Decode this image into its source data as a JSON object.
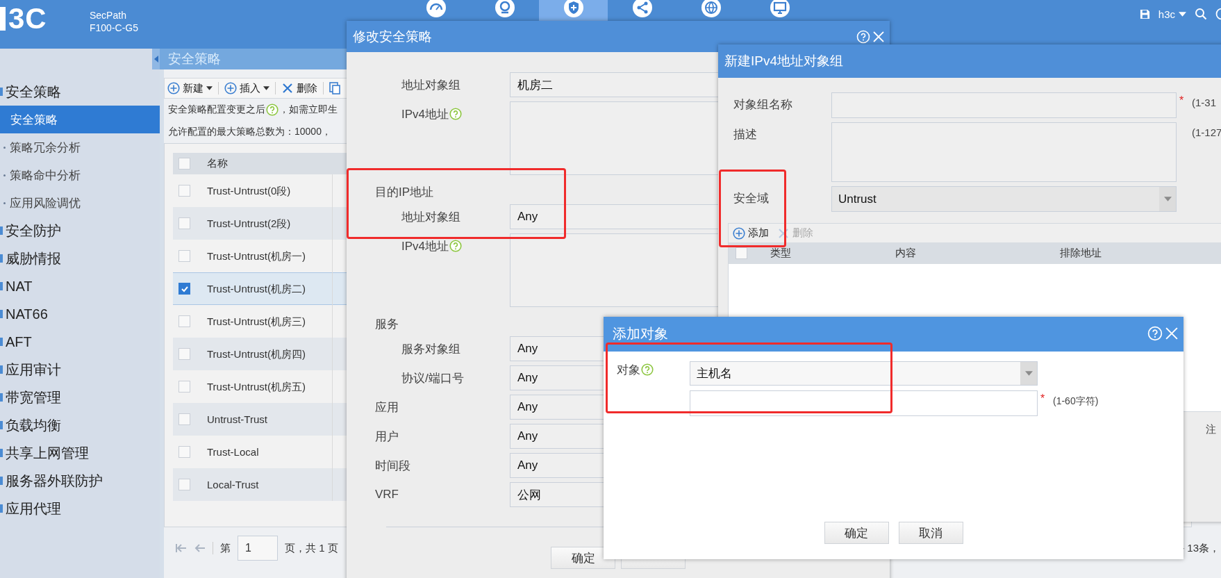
{
  "header": {
    "logo": "3C",
    "product": "SecPath",
    "model": "F100-C-G5",
    "nav": [
      {
        "kind": "gauge",
        "selected": false
      },
      {
        "kind": "camera",
        "selected": false
      },
      {
        "kind": "shield",
        "selected": true
      },
      {
        "kind": "share",
        "selected": false
      },
      {
        "kind": "globe",
        "selected": false
      },
      {
        "kind": "monitor",
        "selected": false
      }
    ],
    "user": "h3c"
  },
  "sidebar": {
    "items": [
      {
        "label": "安全策略",
        "children": [
          {
            "label": "安全策略",
            "selected": true
          },
          {
            "label": "策略冗余分析",
            "selected": false
          },
          {
            "label": "策略命中分析",
            "selected": false
          },
          {
            "label": "应用风险调优",
            "selected": false
          }
        ]
      },
      {
        "label": "安全防护"
      },
      {
        "label": "威胁情报"
      },
      {
        "label": "NAT"
      },
      {
        "label": "NAT66"
      },
      {
        "label": "AFT"
      },
      {
        "label": "应用审计"
      },
      {
        "label": "带宽管理"
      },
      {
        "label": "负载均衡"
      },
      {
        "label": "共享上网管理"
      },
      {
        "label": "服务器外联防护"
      },
      {
        "label": "应用代理"
      }
    ]
  },
  "page": {
    "title": "安全策略",
    "toolbar": [
      {
        "kind": "add",
        "label": "新建",
        "dropdown": true
      },
      {
        "kind": "add",
        "label": "插入",
        "dropdown": true
      },
      {
        "kind": "delete",
        "label": "删除",
        "dropdown": false
      },
      {
        "kind": "copy",
        "dropdown": false
      }
    ],
    "note_before": "安全策略配置变更之后",
    "note_after": "，如需立即生",
    "limit": "允许配置的最大策略总数为：10000，",
    "table": {
      "columns": [
        "名称"
      ],
      "all_checked": false,
      "rows": [
        {
          "name": "Trust-Untrust(0段)",
          "selected": false
        },
        {
          "name": "Trust-Untrust(2段)",
          "selected": false
        },
        {
          "name": "Trust-Untrust(机房一)",
          "selected": false
        },
        {
          "name": "Trust-Untrust(机房二)",
          "selected": true
        },
        {
          "name": "Trust-Untrust(机房三)",
          "selected": false
        },
        {
          "name": "Trust-Untrust(机房四)",
          "selected": false
        },
        {
          "name": "Trust-Untrust(机房五)",
          "selected": false
        },
        {
          "name": "Untrust-Trust",
          "selected": false
        },
        {
          "name": "Trust-Local",
          "selected": false
        },
        {
          "name": "Local-Trust",
          "selected": false
        }
      ]
    },
    "pager": {
      "prefix": "第",
      "page": "1",
      "suffix": "页，共 1 页",
      "range": "- 13条，"
    }
  },
  "edit_policy": {
    "title": "修改安全策略",
    "rows": [
      {
        "kind": "sub-field",
        "label": "地址对象组",
        "value": "机房二",
        "help": false
      },
      {
        "kind": "sub-textarea",
        "label": "IPv4地址",
        "help": true
      },
      {
        "kind": "heading",
        "label": "目的IP地址",
        "help": false
      },
      {
        "kind": "sub-field",
        "label": "地址对象组",
        "value": "Any",
        "help": false
      },
      {
        "kind": "sub-textarea",
        "label": "IPv4地址",
        "help": true
      },
      {
        "kind": "heading",
        "label": "服务",
        "help": false
      },
      {
        "kind": "sub-field",
        "label": "服务对象组",
        "value": "Any",
        "help": false
      },
      {
        "kind": "sub-field",
        "label": "协议/端口号",
        "value": "Any",
        "help": false
      },
      {
        "kind": "field",
        "label": "应用",
        "value": "Any",
        "help": false
      },
      {
        "kind": "field",
        "label": "用户",
        "value": "Any",
        "help": false
      },
      {
        "kind": "field",
        "label": "时间段",
        "value": "Any",
        "help": false
      },
      {
        "kind": "field",
        "label": "VRF",
        "value": "公网",
        "help": false
      }
    ],
    "buttons": [
      {
        "kind": "button",
        "label": "确定"
      },
      {
        "kind": "covered"
      }
    ]
  },
  "new_group": {
    "title": "新建IPv4地址对象组",
    "fields": [
      {
        "kind": "text",
        "label": "对象组名称",
        "mark": "*",
        "hint": "(1-31"
      },
      {
        "kind": "textarea",
        "label": "描述",
        "hint": "(1-127"
      },
      {
        "kind": "select",
        "label": "安全域",
        "value": "Untrust"
      }
    ],
    "toolbar": [
      {
        "kind": "add",
        "label": "添加",
        "disabled": false
      },
      {
        "kind": "delete",
        "label": "删除",
        "disabled": true
      }
    ],
    "columns": [
      "类型",
      "内容",
      "排除地址"
    ],
    "all_checked": false,
    "footnote": "注"
  },
  "add_object": {
    "title": "添加对象",
    "label": "对象",
    "help": true,
    "select_value": "主机名",
    "mark": "*",
    "hint": "(1-60字符)",
    "buttons": [
      "确定",
      "取消"
    ]
  },
  "annotations": [
    {
      "kind": "rectangle"
    },
    {
      "kind": "rectangle"
    },
    {
      "kind": "rectangle"
    }
  ]
}
